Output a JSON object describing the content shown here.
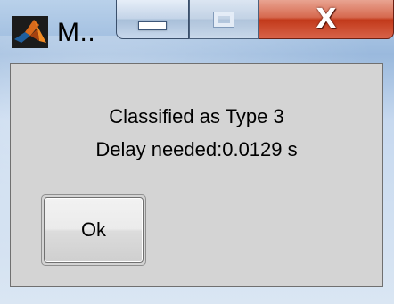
{
  "window": {
    "title": "M..",
    "app_icon": "matlab-logo-icon",
    "caption_buttons": {
      "minimize_icon": "minimize-icon",
      "maximize_icon": "maximize-icon",
      "close_icon": "close-icon",
      "close_glyph": "X"
    }
  },
  "dialog": {
    "message_line1": "Classified as Type 3",
    "message_line2": "Delay needed:0.0129 s",
    "ok_label": "Ok"
  },
  "colors": {
    "client_background": "#d4d4d4",
    "close_button": "#c2391a",
    "frame": "#b9d1ea"
  }
}
